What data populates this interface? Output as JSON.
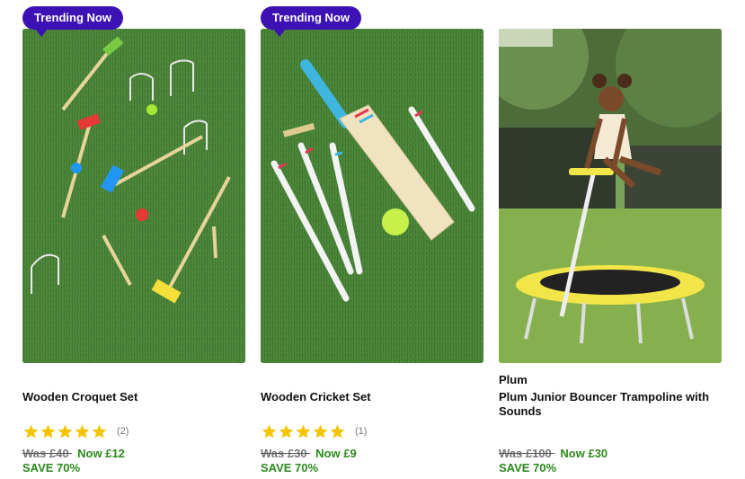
{
  "accent_colors": {
    "badge": "#3c12b5",
    "price_now": "#2c8a1d",
    "star": "#f5c400"
  },
  "products": [
    {
      "badge": "Trending Now",
      "brand": "",
      "title": "Wooden Croquet Set",
      "rating_stars": 5,
      "review_count": "(2)",
      "was_price": "Was  £40 ",
      "now_price": "Now £12",
      "save": "SAVE 70%",
      "image_icon": "croquet-set-photo"
    },
    {
      "badge": "Trending Now",
      "brand": "",
      "title": "Wooden Cricket Set",
      "rating_stars": 5,
      "review_count": "(1)",
      "was_price": "Was  £30 ",
      "now_price": "Now £9",
      "save": "SAVE 70%",
      "image_icon": "cricket-set-photo"
    },
    {
      "badge": "",
      "brand": "Plum",
      "title": "Plum Junior Bouncer Trampoline with Sounds",
      "rating_stars": 0,
      "review_count": "",
      "was_price": "Was  £100 ",
      "now_price": "Now £30",
      "save": "SAVE 70%",
      "image_icon": "trampoline-photo"
    }
  ]
}
